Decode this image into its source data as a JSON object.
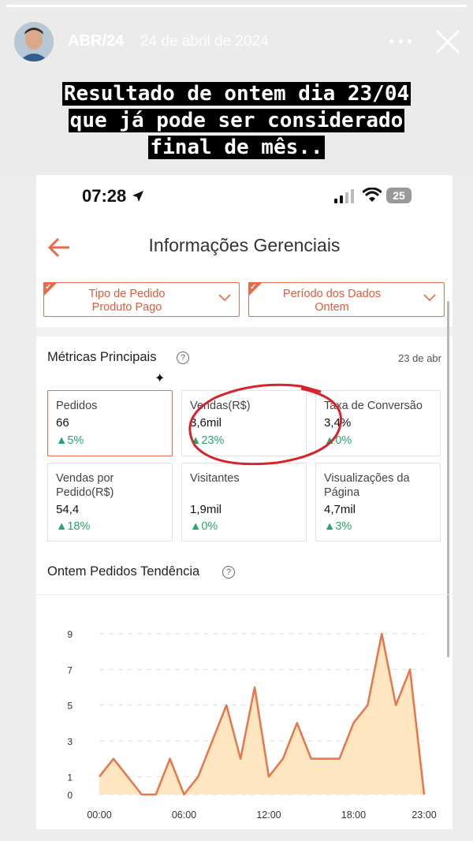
{
  "story": {
    "username": "ABR/24",
    "date": "24 de abril de 2024",
    "caption_lines": [
      "Resultado de ontem dia 23/04",
      "que já pode ser considerado",
      "final de mês.."
    ]
  },
  "phone": {
    "status": {
      "time": "07:28",
      "battery": "25"
    },
    "nav": {
      "title": "Informações Gerenciais"
    },
    "filters": [
      {
        "line1": "Tipo de Pedido",
        "line2": "Produto Pago"
      },
      {
        "line1": "Período dos Dados",
        "line2": "Ontem"
      }
    ],
    "metrics": {
      "title": "Métricas Principais",
      "help": "?",
      "date": "23 de abr",
      "cards": [
        {
          "label": "Pedidos",
          "value": "66",
          "delta": "▲5%"
        },
        {
          "label": "Vendas(R$)",
          "value": "3,6mil",
          "delta": "▲23%"
        },
        {
          "label": "Taxa de Conversão",
          "value": "3,4%",
          "delta": "▲0%"
        },
        {
          "label": "Vendas por Pedido(R$)",
          "value": "54,4",
          "delta": "▲18%"
        },
        {
          "label": "Visitantes",
          "value": "1,9mil",
          "delta": "▲0%"
        },
        {
          "label": "Visualizações da Página",
          "value": "4,7mil",
          "delta": "▲3%"
        }
      ]
    },
    "trend": {
      "title": "Ontem Pedidos Tendência",
      "help": "?"
    }
  },
  "colors": {
    "accent": "#e86a4a",
    "positive": "#27a86a",
    "line": "#e8764a",
    "area": "#fde6c0",
    "annotation": "#d8232a"
  },
  "chart_data": {
    "type": "area",
    "x": [
      0,
      1,
      2,
      3,
      4,
      5,
      6,
      7,
      8,
      9,
      10,
      11,
      12,
      13,
      14,
      15,
      16,
      17,
      18,
      19,
      20,
      21,
      22,
      23
    ],
    "x_tick_labels": [
      "00:00",
      "06:00",
      "12:00",
      "18:00",
      "23:00"
    ],
    "x_tick_positions": [
      0,
      6,
      12,
      18,
      23
    ],
    "y_ticks": [
      0,
      1,
      3,
      5,
      7,
      9
    ],
    "values": [
      1,
      2,
      1,
      0,
      0,
      2,
      0,
      1,
      3,
      5,
      2,
      6,
      1,
      2,
      4,
      2,
      2,
      2,
      4,
      5,
      9,
      5,
      7,
      0
    ],
    "ylim": [
      0,
      9
    ]
  }
}
